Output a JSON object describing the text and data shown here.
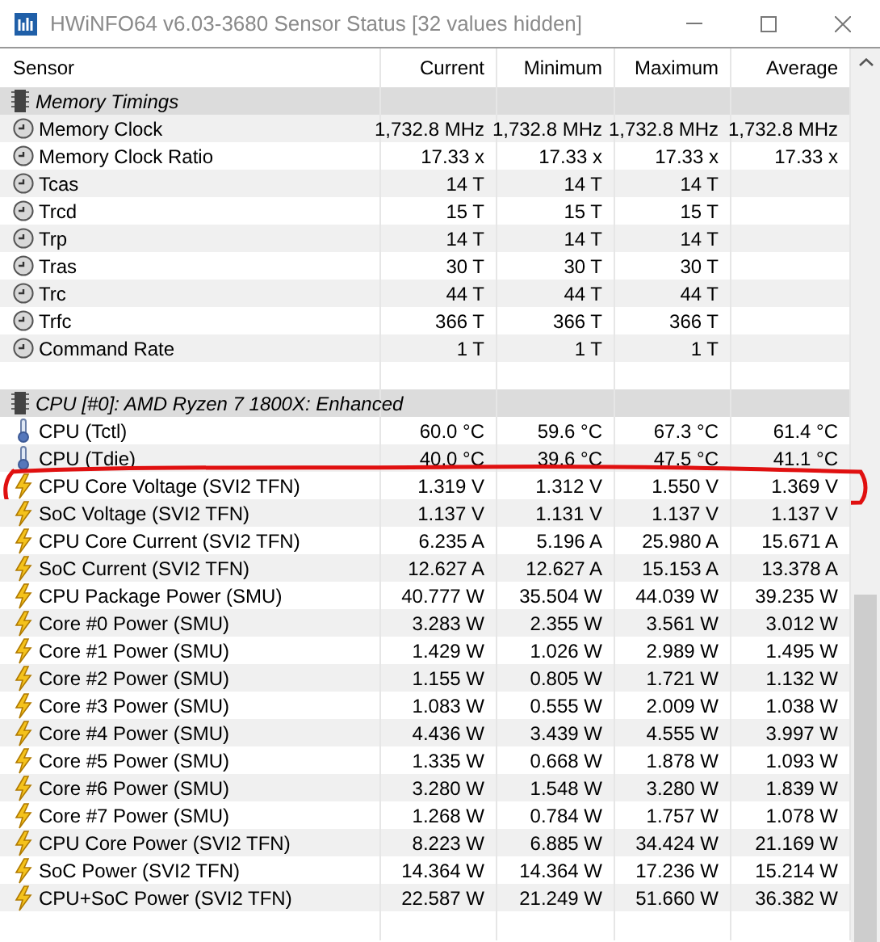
{
  "window": {
    "title": "HWiNFO64 v6.03-3680 Sensor Status [32 values hidden]"
  },
  "columns": [
    "Sensor",
    "Current",
    "Minimum",
    "Maximum",
    "Average"
  ],
  "groups": [
    {
      "name": "Memory Timings",
      "rows": [
        {
          "kind": "clock",
          "label": "Memory Clock",
          "values": [
            "1,732.8 MHz",
            "1,732.8 MHz",
            "1,732.8 MHz",
            "1,732.8 MHz"
          ],
          "circled": false
        },
        {
          "kind": "clock",
          "label": "Memory Clock Ratio",
          "values": [
            "17.33 x",
            "17.33 x",
            "17.33 x",
            "17.33 x"
          ],
          "circled": false
        },
        {
          "kind": "clock",
          "label": "Tcas",
          "values": [
            "14 T",
            "14 T",
            "14 T"
          ],
          "circled": false
        },
        {
          "kind": "clock",
          "label": "Trcd",
          "values": [
            "15 T",
            "15 T",
            "15 T"
          ],
          "circled": false
        },
        {
          "kind": "clock",
          "label": "Trp",
          "values": [
            "14 T",
            "14 T",
            "14 T"
          ],
          "circled": false
        },
        {
          "kind": "clock",
          "label": "Tras",
          "values": [
            "30 T",
            "30 T",
            "30 T"
          ],
          "circled": false
        },
        {
          "kind": "clock",
          "label": "Trc",
          "values": [
            "44 T",
            "44 T",
            "44 T"
          ],
          "circled": false
        },
        {
          "kind": "clock",
          "label": "Trfc",
          "values": [
            "366 T",
            "366 T",
            "366 T"
          ],
          "circled": false
        },
        {
          "kind": "clock",
          "label": "Command Rate",
          "values": [
            "1 T",
            "1 T",
            "1 T"
          ],
          "circled": false
        }
      ]
    },
    {
      "name": "CPU [#0]: AMD Ryzen 7 1800X: Enhanced",
      "rows": [
        {
          "kind": "temperature",
          "label": "CPU (Tctl)",
          "values": [
            "60.0 °C",
            "59.6 °C",
            "67.3 °C",
            "61.4 °C"
          ],
          "circled": false
        },
        {
          "kind": "temperature",
          "label": "CPU (Tdie)",
          "values": [
            "40.0 °C",
            "39.6 °C",
            "47.5 °C",
            "41.1 °C"
          ],
          "circled": false
        },
        {
          "kind": "power",
          "label": "CPU Core Voltage (SVI2 TFN)",
          "values": [
            "1.319 V",
            "1.312 V",
            "1.550 V",
            "1.369 V"
          ],
          "circled": true
        },
        {
          "kind": "power",
          "label": "SoC Voltage (SVI2 TFN)",
          "values": [
            "1.137 V",
            "1.131 V",
            "1.137 V",
            "1.137 V"
          ],
          "circled": false
        },
        {
          "kind": "power",
          "label": "CPU Core Current (SVI2 TFN)",
          "values": [
            "6.235 A",
            "5.196 A",
            "25.980 A",
            "15.671 A"
          ],
          "circled": false
        },
        {
          "kind": "power",
          "label": "SoC Current (SVI2 TFN)",
          "values": [
            "12.627 A",
            "12.627 A",
            "15.153 A",
            "13.378 A"
          ],
          "circled": false
        },
        {
          "kind": "power",
          "label": "CPU Package Power (SMU)",
          "values": [
            "40.777 W",
            "35.504 W",
            "44.039 W",
            "39.235 W"
          ],
          "circled": false
        },
        {
          "kind": "power",
          "label": "Core #0 Power (SMU)",
          "values": [
            "3.283 W",
            "2.355 W",
            "3.561 W",
            "3.012 W"
          ],
          "circled": false
        },
        {
          "kind": "power",
          "label": "Core #1 Power (SMU)",
          "values": [
            "1.429 W",
            "1.026 W",
            "2.989 W",
            "1.495 W"
          ],
          "circled": false
        },
        {
          "kind": "power",
          "label": "Core #2 Power (SMU)",
          "values": [
            "1.155 W",
            "0.805 W",
            "1.721 W",
            "1.132 W"
          ],
          "circled": false
        },
        {
          "kind": "power",
          "label": "Core #3 Power (SMU)",
          "values": [
            "1.083 W",
            "0.555 W",
            "2.009 W",
            "1.038 W"
          ],
          "circled": false
        },
        {
          "kind": "power",
          "label": "Core #4 Power (SMU)",
          "values": [
            "4.436 W",
            "3.439 W",
            "4.555 W",
            "3.997 W"
          ],
          "circled": false
        },
        {
          "kind": "power",
          "label": "Core #5 Power (SMU)",
          "values": [
            "1.335 W",
            "0.668 W",
            "1.878 W",
            "1.093 W"
          ],
          "circled": false
        },
        {
          "kind": "power",
          "label": "Core #6 Power (SMU)",
          "values": [
            "3.280 W",
            "1.548 W",
            "3.280 W",
            "1.839 W"
          ],
          "circled": false
        },
        {
          "kind": "power",
          "label": "Core #7 Power (SMU)",
          "values": [
            "1.268 W",
            "0.784 W",
            "1.757 W",
            "1.078 W"
          ],
          "circled": false
        },
        {
          "kind": "power",
          "label": "CPU Core Power (SVI2 TFN)",
          "values": [
            "8.223 W",
            "6.885 W",
            "34.424 W",
            "21.169 W"
          ],
          "circled": false
        },
        {
          "kind": "power",
          "label": "SoC Power (SVI2 TFN)",
          "values": [
            "14.364 W",
            "14.364 W",
            "17.236 W",
            "15.214 W"
          ],
          "circled": false
        },
        {
          "kind": "power",
          "label": "CPU+SoC Power (SVI2 TFN)",
          "values": [
            "22.587 W",
            "21.249 W",
            "51.660 W",
            "36.382 W"
          ],
          "circled": false
        }
      ]
    }
  ]
}
